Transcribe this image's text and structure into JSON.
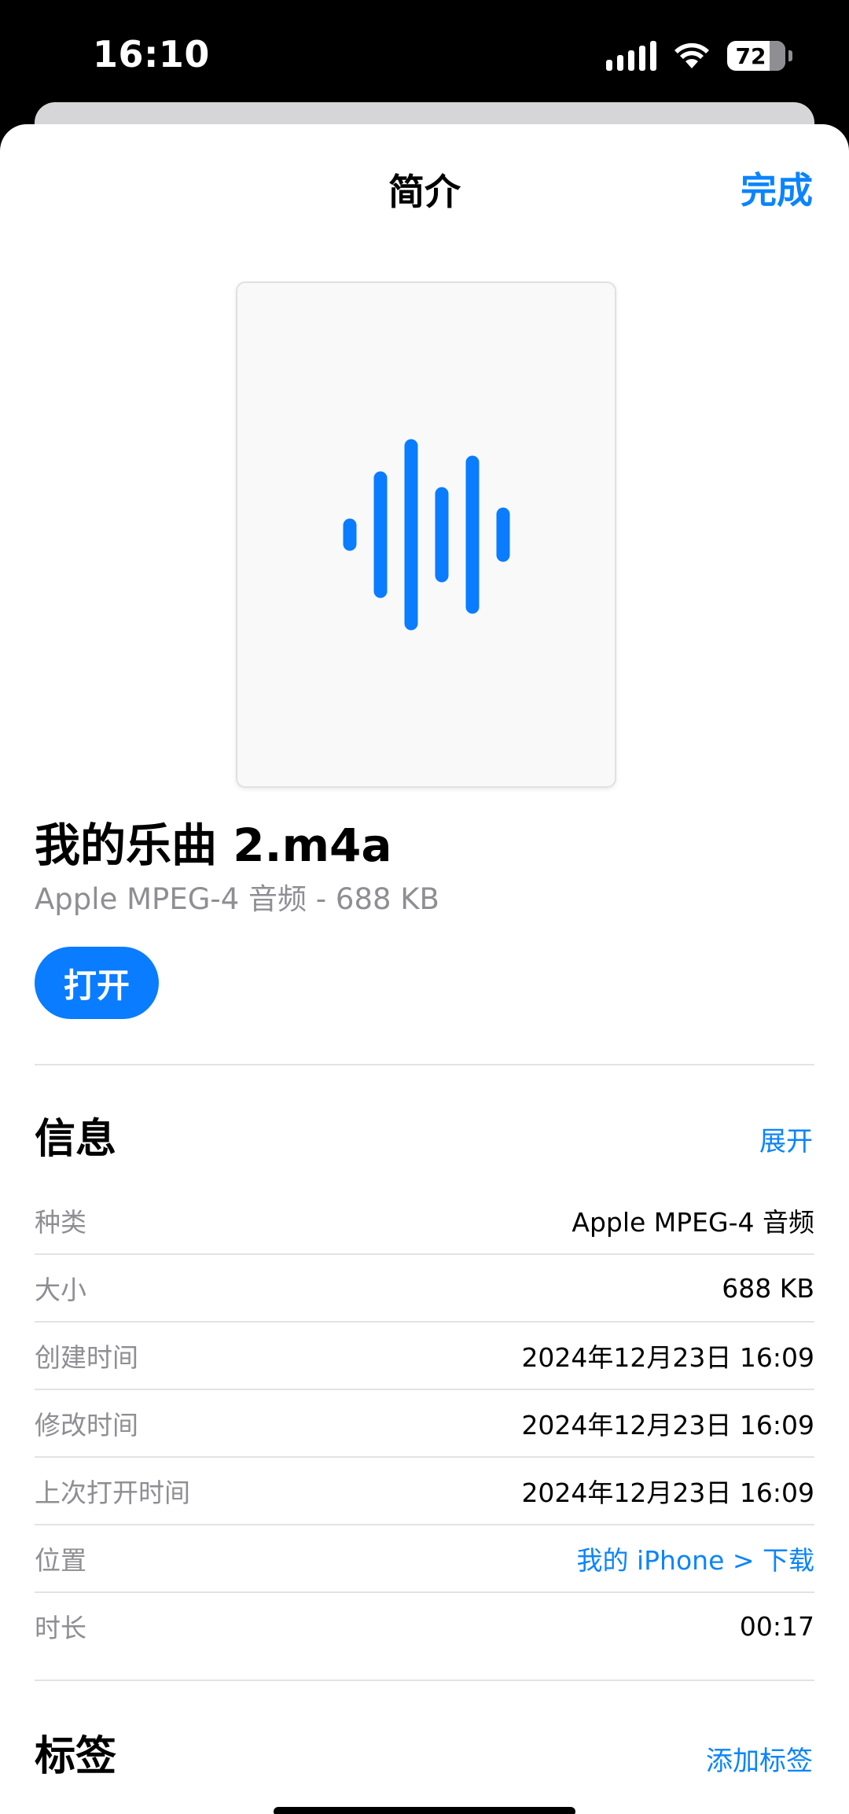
{
  "status_bar": {
    "time": "16:10",
    "battery": "72",
    "icons": [
      "signal-icon",
      "wifi-icon",
      "battery-icon"
    ]
  },
  "nav": {
    "title": "简介",
    "done_label": "完成"
  },
  "file": {
    "name": "我的乐曲 2.m4a",
    "subtitle": "Apple MPEG-4 音频 - 688 KB",
    "preview_icon": "waveform-icon",
    "open_label": "打开"
  },
  "info": {
    "title": "信息",
    "expand_label": "展开",
    "rows": [
      {
        "label": "种类",
        "value": "Apple MPEG-4 音频"
      },
      {
        "label": "大小",
        "value": "688 KB"
      },
      {
        "label": "创建时间",
        "value": "2024年12月23日 16:09"
      },
      {
        "label": "修改时间",
        "value": "2024年12月23日 16:09"
      },
      {
        "label": "上次打开时间",
        "value": "2024年12月23日 16:09"
      },
      {
        "label": "位置",
        "value": "我的 iPhone > 下载"
      },
      {
        "label": "时长",
        "value": "00:17"
      }
    ]
  },
  "tags": {
    "title": "标签",
    "add_label": "添加标签"
  },
  "colors": {
    "accent": "#0a84ff",
    "secondary_text": "#8e8e93",
    "divider": "#e3e3e6"
  }
}
